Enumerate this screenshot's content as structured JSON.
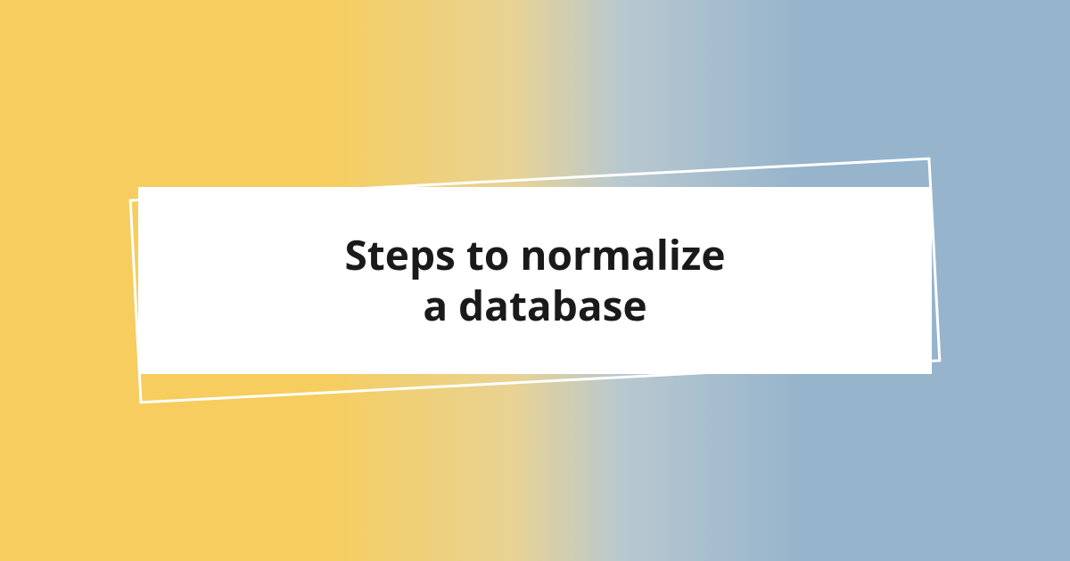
{
  "title_line1": "Steps to normalize",
  "title_line2": "a database"
}
